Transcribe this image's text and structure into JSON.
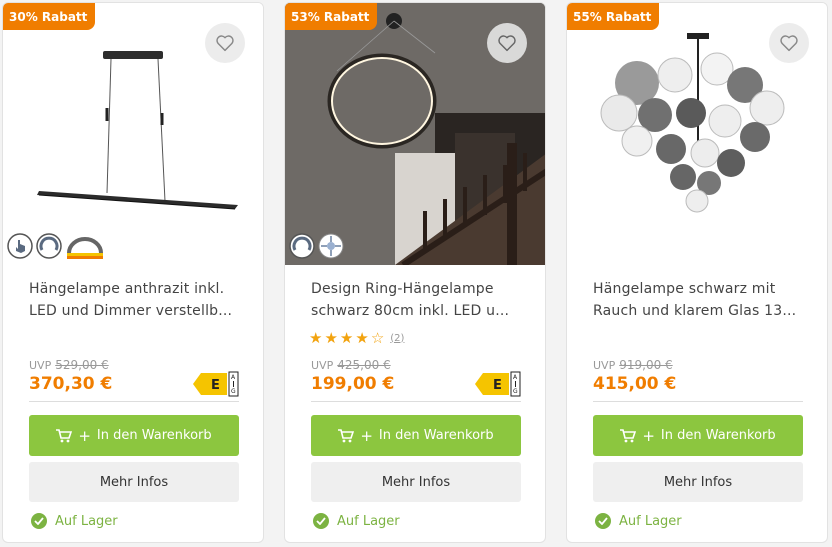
{
  "products": [
    {
      "badge": "30% Rabatt",
      "title_line1": "Hängelampe anthrazit inkl.",
      "title_line2": "LED und Dimmer verstellb...",
      "uvp_label": "UVP",
      "uvp_price": "529,00 €",
      "price": "370,30 €",
      "energy_class": "E",
      "energy_range_top": "A",
      "energy_range_bottom": "G",
      "cart_label": "In den Warenkorb",
      "info_label": "Mehr Infos",
      "stock_label": "Auf Lager"
    },
    {
      "badge": "53% Rabatt",
      "title_line1": "Design Ring-Hängelampe",
      "title_line2": "schwarz 80cm inkl. LED u...",
      "rating": 4,
      "review_count": "(2)",
      "uvp_label": "UVP",
      "uvp_price": "425,00 €",
      "price": "199,00 €",
      "energy_class": "E",
      "energy_range_top": "A",
      "energy_range_bottom": "G",
      "cart_label": "In den Warenkorb",
      "info_label": "Mehr Infos",
      "stock_label": "Auf Lager"
    },
    {
      "badge": "55% Rabatt",
      "title_line1": "Hängelampe schwarz mit",
      "title_line2": "Rauch und klarem Glas 13...",
      "uvp_label": "UVP",
      "uvp_price": "919,00 €",
      "price": "415,00 €",
      "cart_label": "In den Warenkorb",
      "info_label": "Mehr Infos",
      "stock_label": "Auf Lager"
    }
  ],
  "colors": {
    "accent_orange": "#f07d00",
    "cart_green": "#8cc63f",
    "stock_green": "#7cb342",
    "energy_yellow": "#f5c400"
  },
  "icons": [
    "heart-icon",
    "cart-icon",
    "plus-icon",
    "check-icon",
    "touch-dimmer-icon",
    "dimmer-icon",
    "height-adjustable-icon",
    "smart-icon"
  ]
}
